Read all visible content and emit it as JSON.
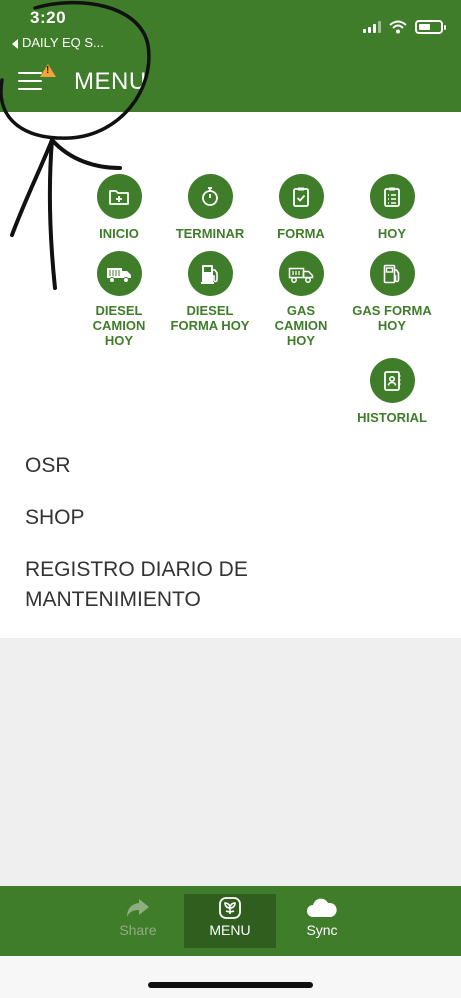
{
  "status_bar": {
    "time": "3:20",
    "back_app": "DAILY EQ S..."
  },
  "header": {
    "title": "MENU"
  },
  "tiles": [
    {
      "label": "INICIO",
      "icon": "folder-plus-icon"
    },
    {
      "label": "TERMINAR",
      "icon": "stopwatch-icon"
    },
    {
      "label": "FORMA",
      "icon": "clipboard-check-icon"
    },
    {
      "label": "HOY",
      "icon": "clipboard-list-icon"
    },
    {
      "label": "DIESEL\nCAMION\nHOY",
      "icon": "truck-icon"
    },
    {
      "label": "DIESEL\nFORMA HOY",
      "icon": "gas-pump-icon"
    },
    {
      "label": "GAS\nCAMION\nHOY",
      "icon": "truck-icon"
    },
    {
      "label": "GAS FORMA\nHOY",
      "icon": "gas-pump-outline-icon"
    },
    {
      "label": "HISTORIAL",
      "icon": "contact-book-icon"
    }
  ],
  "menu_items": [
    {
      "label": "OSR"
    },
    {
      "label": "SHOP"
    },
    {
      "label": "REGISTRO DIARIO DE MANTENIMIENTO"
    }
  ],
  "tabbar": {
    "share": "Share",
    "menu": "MENU",
    "sync": "Sync"
  },
  "colors": {
    "brand_green": "#3f7d2a",
    "active_tab": "#2f5e1f",
    "warning": "#f4a23a"
  }
}
